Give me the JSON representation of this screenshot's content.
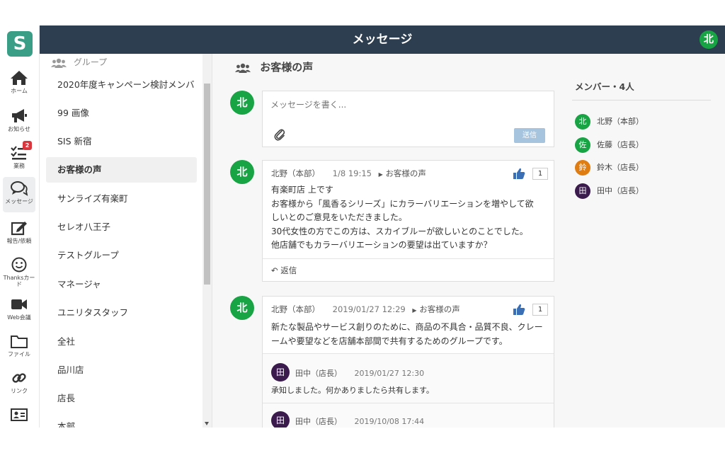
{
  "app": {
    "logo_letter": "S",
    "title": "メッセージ",
    "user_avatar": "北"
  },
  "nav": [
    {
      "id": "home",
      "label": "ホーム",
      "icon": "home-icon"
    },
    {
      "id": "notice",
      "label": "お知らせ",
      "icon": "megaphone-icon"
    },
    {
      "id": "tasks",
      "label": "業務",
      "icon": "checklist-icon",
      "badge": "2"
    },
    {
      "id": "message",
      "label": "メッセージ",
      "icon": "chat-icon",
      "active": true
    },
    {
      "id": "report",
      "label": "報告/依頼",
      "icon": "edit-icon"
    },
    {
      "id": "thanks",
      "label": "Thanksカード",
      "icon": "smile-icon"
    },
    {
      "id": "web",
      "label": "Web会議",
      "icon": "video-icon"
    },
    {
      "id": "file",
      "label": "ファイル",
      "icon": "folder-icon"
    },
    {
      "id": "link",
      "label": "リンク",
      "icon": "link-icon"
    },
    {
      "id": "profile",
      "label": "",
      "icon": "id-card-icon"
    }
  ],
  "groups": {
    "header": "グループ",
    "items": [
      "2020年度キャンペーン検討メンバ",
      "99 画像",
      "SIS 新宿",
      "お客様の声",
      "サンライズ有楽町",
      "セレオ八王子",
      "テストグループ",
      "マネージャ",
      "ユニリタスタッフ",
      "全社",
      "品川店",
      "店長",
      "本部"
    ],
    "active_index": 3
  },
  "channel": {
    "title": "お客様の声"
  },
  "composer": {
    "avatar": "北",
    "placeholder": "メッセージを書く...",
    "send_label": "送信"
  },
  "messages": [
    {
      "avatar": "北",
      "author": "北野（本部）",
      "time": "1/8 19:15",
      "channel": "お客様の声",
      "likes": "1",
      "lines": [
        "有楽町店 上です",
        "お客様から「風香るシリーズ」にカラーバリエーションを増やして欲",
        "しいとのご意見をいただきました。",
        "30代女性の方でこの方は、スカイブルーが欲しいとのことでした。",
        "他店舗でもカラーバリエーションの要望は出ていますか？"
      ],
      "reply_label": "返信"
    },
    {
      "avatar": "北",
      "author": "北野（本部）",
      "time": "2019/01/27 12:29",
      "channel": "お客様の声",
      "likes": "1",
      "lines": [
        "新たな製品やサービス創りのために、商品の不具合・品質不良、クレー",
        "ームや要望などを店舗本部間で共有するためのグループです。"
      ],
      "replies": [
        {
          "avatar": "田",
          "author": "田中（店長）",
          "time": "2019/01/27 12:30",
          "text": "承知しました。何かありましたら共有します。"
        },
        {
          "avatar": "田",
          "author": "田中（店長）",
          "time": "2019/10/08 17:44",
          "text": ""
        }
      ]
    }
  ],
  "members": {
    "title": "メンバー・4人",
    "list": [
      {
        "avatar": "北",
        "name": "北野（本部）",
        "color": "#18a344"
      },
      {
        "avatar": "佐",
        "name": "佐藤（店長）",
        "color": "#18a344"
      },
      {
        "avatar": "鈴",
        "name": "鈴木（店長）",
        "color": "#e07d12"
      },
      {
        "avatar": "田",
        "name": "田中（店長）",
        "color": "#3b1a4e"
      }
    ]
  },
  "colors": {
    "header_bg": "#2c3e50",
    "brand": "#3a9e86",
    "avatar_green": "#18a344",
    "avatar_purple": "#3b1a4e",
    "avatar_orange": "#e07d12",
    "like_blue": "#3b6fb5",
    "badge_red": "#d9363e"
  }
}
